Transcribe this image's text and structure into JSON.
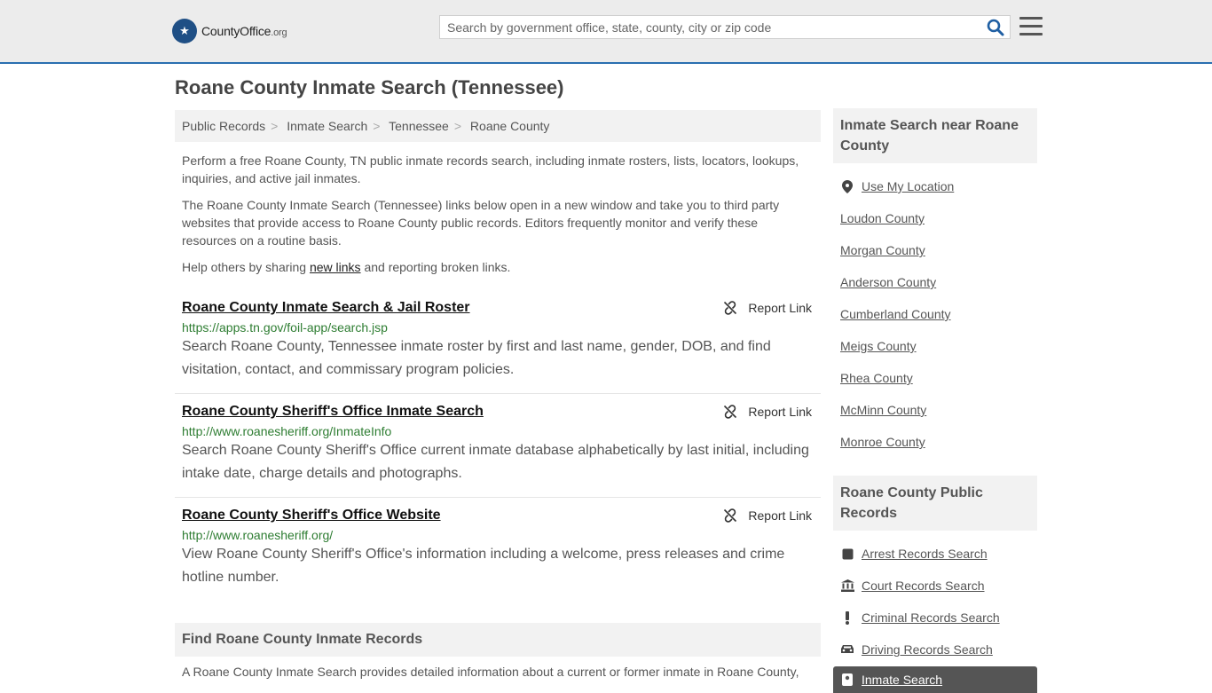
{
  "header": {
    "logo_text": "CountyOffice",
    "logo_tld": ".org",
    "search_placeholder": "Search by government office, state, county, city or zip code"
  },
  "page_title": "Roane County Inmate Search (Tennessee)",
  "breadcrumb": [
    "Public Records",
    "Inmate Search",
    "Tennessee",
    "Roane County"
  ],
  "intro": {
    "p1": "Perform a free Roane County, TN public inmate records search, including inmate rosters, lists, locators, lookups, inquiries, and active jail inmates.",
    "p2": "The Roane County Inmate Search (Tennessee) links below open in a new window and take you to third party websites that provide access to Roane County public records. Editors frequently monitor and verify these resources on a routine basis.",
    "p3_before": "Help others by sharing ",
    "p3_link": "new links",
    "p3_after": " and reporting broken links."
  },
  "report_label": "Report Link",
  "results": [
    {
      "title": "Roane County Inmate Search & Jail Roster",
      "url": "https://apps.tn.gov/foil-app/search.jsp",
      "desc": "Search Roane County, Tennessee inmate roster by first and last name, gender, DOB, and find visitation, contact, and commissary program policies."
    },
    {
      "title": "Roane County Sheriff's Office Inmate Search",
      "url": "http://www.roanesheriff.org/InmateInfo",
      "desc": "Search Roane County Sheriff's Office current inmate database alphabetically by last initial, including intake date, charge details and photographs."
    },
    {
      "title": "Roane County Sheriff's Office Website",
      "url": "http://www.roanesheriff.org/",
      "desc": "View Roane County Sheriff's Office's information including a welcome, press releases and crime hotline number."
    }
  ],
  "find": {
    "heading": "Find Roane County Inmate Records",
    "text": "A Roane County Inmate Search provides detailed information about a current or former inmate in Roane County,"
  },
  "sidebar": {
    "nearby_heading": "Inmate Search near Roane County",
    "use_location": "Use My Location",
    "nearby": [
      "Loudon County",
      "Morgan County",
      "Anderson County",
      "Cumberland County",
      "Meigs County",
      "Rhea County",
      "McMinn County",
      "Monroe County"
    ],
    "records_heading": "Roane County Public Records",
    "records": [
      {
        "label": "Arrest Records Search",
        "icon": "square-icon"
      },
      {
        "label": "Court Records Search",
        "icon": "courthouse-icon"
      },
      {
        "label": "Criminal Records Search",
        "icon": "exclamation-icon"
      },
      {
        "label": "Driving Records Search",
        "icon": "car-icon"
      }
    ],
    "active": "Inmate Search"
  }
}
